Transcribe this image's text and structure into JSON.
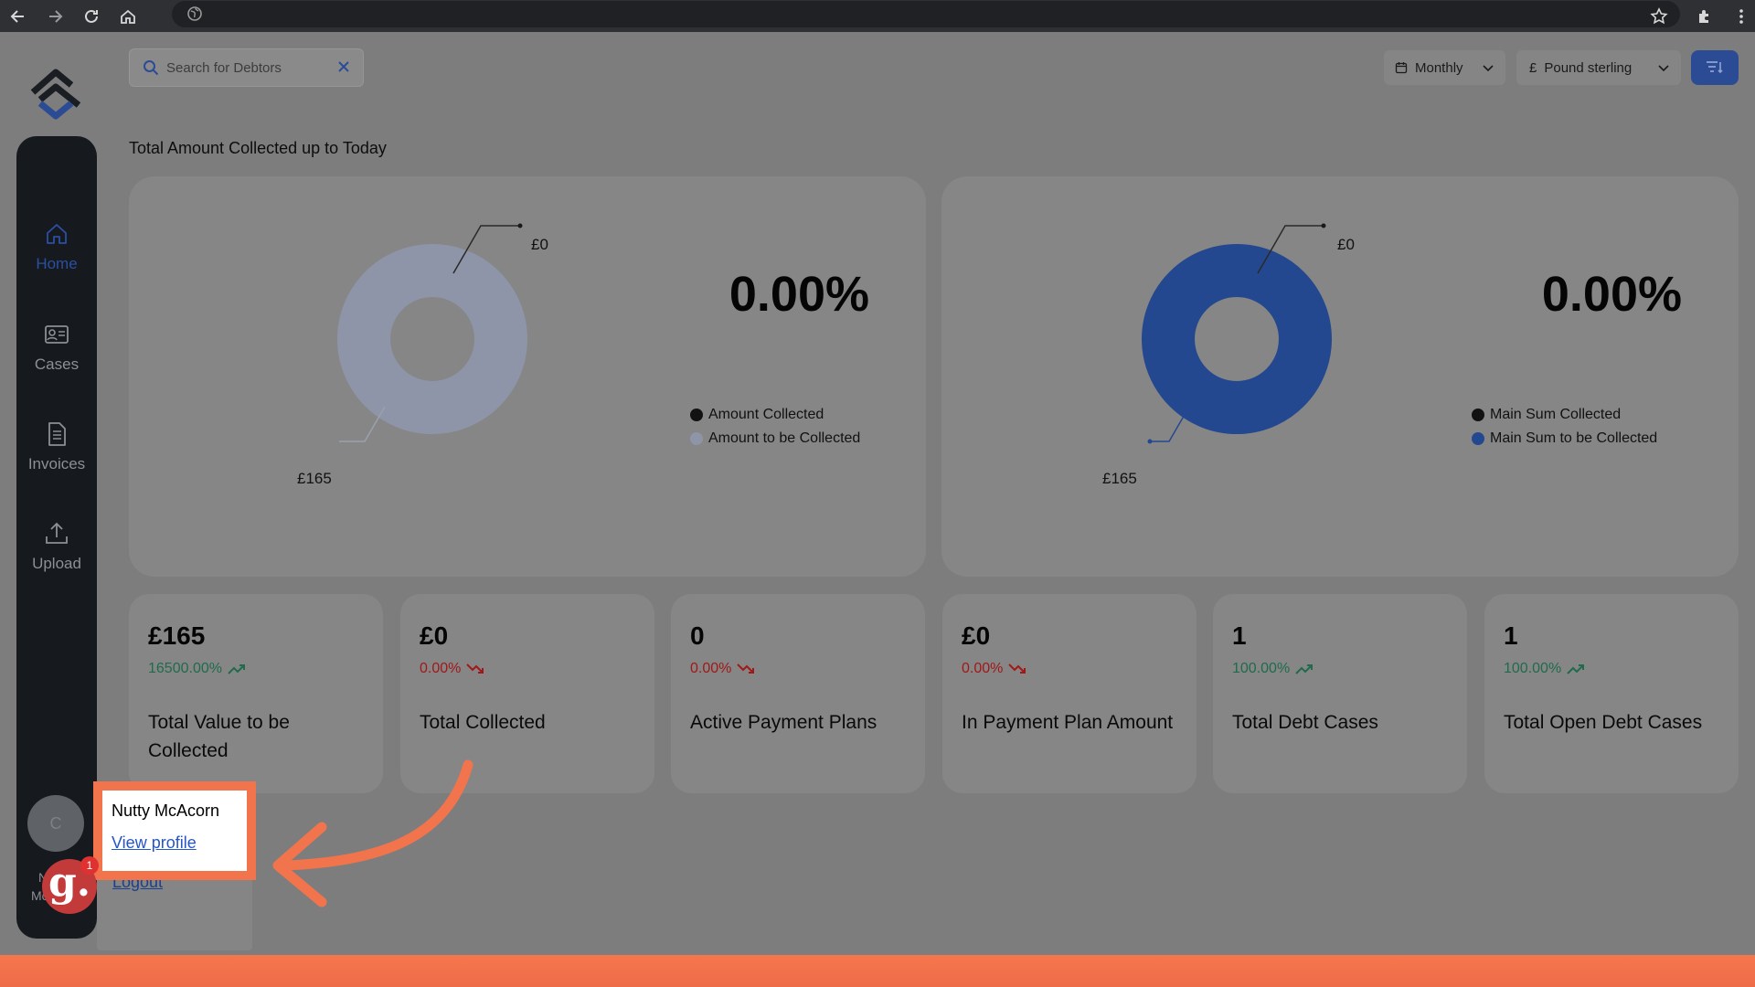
{
  "search": {
    "placeholder": "Search for Debtors"
  },
  "controls": {
    "period": "Monthly",
    "currency_symbol": "£",
    "currency": "Pound sterling"
  },
  "sidebar": {
    "items": [
      {
        "label": "Home",
        "icon": "home-icon",
        "active": true
      },
      {
        "label": "Cases",
        "icon": "id-card-icon",
        "active": false
      },
      {
        "label": "Invoices",
        "icon": "document-icon",
        "active": false
      },
      {
        "label": "Upload",
        "icon": "upload-icon",
        "active": false
      }
    ],
    "avatar_initial": "C",
    "name_fragment_1": "N",
    "name_fragment_2": "Mc"
  },
  "section_title": "Total Amount Collected up to Today",
  "charts": [
    {
      "percentage": "0.00%",
      "label_top": "£0",
      "label_bottom": "£165",
      "legend": [
        "Amount Collected",
        "Amount to be Collected"
      ],
      "colors": [
        "#121212",
        "#8e95a8"
      ]
    },
    {
      "percentage": "0.00%",
      "label_top": "£0",
      "label_bottom": "£165",
      "legend": [
        "Main Sum Collected",
        "Main Sum to be Collected"
      ],
      "colors": [
        "#121212",
        "#24488f"
      ]
    }
  ],
  "chart_data": [
    {
      "type": "pie",
      "categories": [
        "Amount Collected",
        "Amount to be Collected"
      ],
      "values": [
        0,
        165
      ]
    },
    {
      "type": "pie",
      "categories": [
        "Main Sum Collected",
        "Main Sum to be Collected"
      ],
      "values": [
        0,
        165
      ]
    }
  ],
  "stats": [
    {
      "value": "£165",
      "change": "16500.00%",
      "trend": "up",
      "title": "Total Value to be Collected"
    },
    {
      "value": "£0",
      "change": "0.00%",
      "trend": "down",
      "title": "Total Collected"
    },
    {
      "value": "0",
      "change": "0.00%",
      "trend": "down",
      "title": "Active Payment Plans"
    },
    {
      "value": "£0",
      "change": "0.00%",
      "trend": "down",
      "title": "In Payment Plan Amount"
    },
    {
      "value": "1",
      "change": "100.00%",
      "trend": "up",
      "title": "Total Debt Cases"
    },
    {
      "value": "1",
      "change": "100.00%",
      "trend": "up",
      "title": "Total Open Debt Cases"
    }
  ],
  "user_menu": {
    "name": "Nutty McAcorn",
    "view_profile": "View profile",
    "logout": "Logout"
  },
  "badge": {
    "letter": "g.",
    "count": "1"
  },
  "colors": {
    "accent": "#2b4b95",
    "highlight": "#f2744c",
    "up": "#1f6b4c",
    "down": "#a01818"
  }
}
